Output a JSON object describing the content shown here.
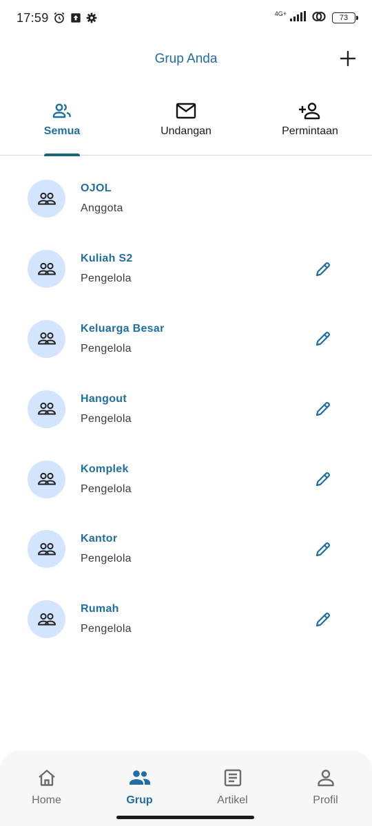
{
  "status_bar": {
    "time": "17:59",
    "network": "4G+",
    "battery": "73"
  },
  "header": {
    "title": "Grup Anda"
  },
  "tabs": [
    {
      "label": "Semua",
      "icon": "group-icon",
      "active": true
    },
    {
      "label": "Undangan",
      "icon": "mail-icon",
      "active": false
    },
    {
      "label": "Permintaan",
      "icon": "person-add-icon",
      "active": false
    }
  ],
  "groups": [
    {
      "name": "OJOL",
      "role": "Anggota",
      "editable": false
    },
    {
      "name": "Kuliah S2",
      "role": "Pengelola",
      "editable": true
    },
    {
      "name": "Keluarga Besar",
      "role": "Pengelola",
      "editable": true
    },
    {
      "name": "Hangout",
      "role": "Pengelola",
      "editable": true
    },
    {
      "name": "Komplek",
      "role": "Pengelola",
      "editable": true
    },
    {
      "name": "Kantor",
      "role": "Pengelola",
      "editable": true
    },
    {
      "name": "Rumah",
      "role": "Pengelola",
      "editable": true
    }
  ],
  "bottom_nav": [
    {
      "label": "Home",
      "icon": "home-icon",
      "active": false
    },
    {
      "label": "Grup",
      "icon": "group-icon",
      "active": true
    },
    {
      "label": "Artikel",
      "icon": "article-icon",
      "active": false
    },
    {
      "label": "Profil",
      "icon": "person-icon",
      "active": false
    }
  ],
  "colors": {
    "accent": "#1f6ea3",
    "avatar_bg": "#d3e4ff",
    "tab_indicator": "#1c6477"
  }
}
